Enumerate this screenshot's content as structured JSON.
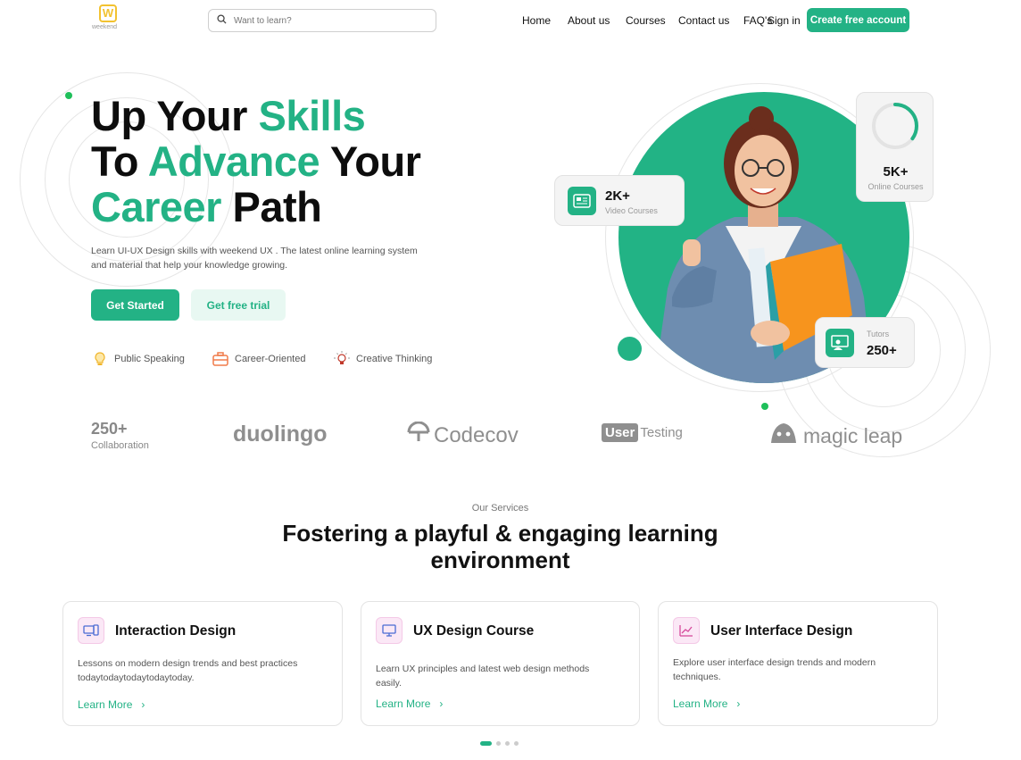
{
  "brand": {
    "logo_text": "weekend"
  },
  "search": {
    "placeholder": "Want to learn?"
  },
  "nav": {
    "items": [
      "Home",
      "About us",
      "Courses",
      "Contact us",
      "FAQ's",
      "Sign in"
    ],
    "cta": "Create free account"
  },
  "hero": {
    "title_line1_a": "Up Your ",
    "title_line1_b": "Skills",
    "title_line2_a": "To ",
    "title_line2_b": "Advance",
    "title_line2_c": " Your",
    "title_line3_a": "Career",
    "title_line3_b": " Path",
    "description": "Learn UI-UX Design skills with weekend UX . The latest online learning system and material that help your knowledge growing.",
    "primary_button": "Get Started",
    "secondary_button": "Get free trial",
    "features": [
      "Public Speaking",
      "Career-Oriented",
      "Creative Thinking"
    ]
  },
  "stats": {
    "videos": {
      "value": "2K+",
      "label": "Video Courses"
    },
    "online": {
      "value": "5K+",
      "label": "Online Courses",
      "progress": 0.35
    },
    "tutors": {
      "value": "250+",
      "label": "Tutors"
    }
  },
  "partners": {
    "collab_value": "250+",
    "collab_label": "Collaboration",
    "logos": [
      "duolingo",
      "Codecov",
      "User",
      "Testing",
      "magic leap"
    ]
  },
  "services": {
    "eyebrow": "Our Services",
    "title_line1": "Fostering a playful & engaging learning",
    "title_line2": "environment",
    "cards": [
      {
        "name": "Interaction Design",
        "desc": "Lessons on modern design trends and best practices todaytodaytodaytodaytoday.",
        "link": "Learn More"
      },
      {
        "name": "UX Design Course",
        "desc": "Learn UX principles and latest web design methods easily.",
        "link": "Learn More"
      },
      {
        "name": "User Interface Design",
        "desc": "Explore user interface design trends and modern techniques.",
        "link": "Learn More"
      }
    ]
  },
  "colors": {
    "accent": "#23b285",
    "accent_light": "#e8f8f2",
    "dot": "#1fbf5a"
  }
}
